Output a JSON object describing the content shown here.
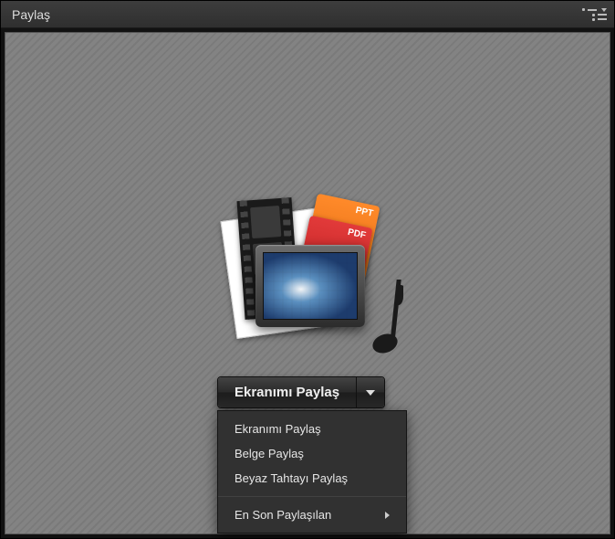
{
  "header": {
    "title": "Paylaş"
  },
  "share_button": {
    "label": "Ekranımı Paylaş"
  },
  "doc_labels": {
    "ppt": "PPT",
    "pdf": "PDF"
  },
  "menu": {
    "items": [
      {
        "label": "Ekranımı Paylaş",
        "has_submenu": false
      },
      {
        "label": "Belge Paylaş",
        "has_submenu": false
      },
      {
        "label": "Beyaz Tahtayı Paylaş",
        "has_submenu": false
      }
    ],
    "recent": {
      "label": "En Son Paylaşılan",
      "has_submenu": true
    }
  }
}
